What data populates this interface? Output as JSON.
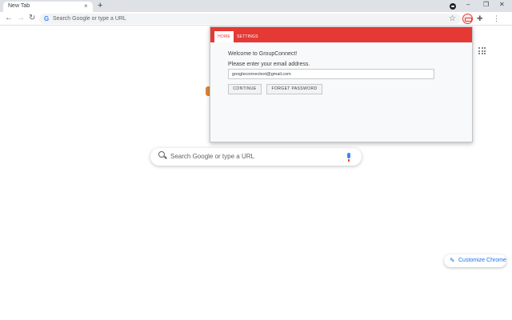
{
  "browser": {
    "tab_title": "New Tab",
    "tab_close": "×",
    "new_tab": "+",
    "win_min": "–",
    "win_restore": "❐",
    "win_close": "✕",
    "nav_back": "←",
    "nav_forward": "→",
    "nav_reload": "↻",
    "omnibox_placeholder": "Search Google or type a URL",
    "star_glyph": "☆",
    "puzzle_glyph": "✚",
    "menu_glyph": "⋮",
    "accent": "#1a73e8"
  },
  "ntp": {
    "search_placeholder": "Search Google or type a URL",
    "customize_label": "Customize Chrome",
    "pencil_glyph": "✎"
  },
  "popup": {
    "brand_color": "#e53935",
    "tabs": [
      {
        "label": "HOME",
        "active": true
      },
      {
        "label": "SETTINGS",
        "active": false
      }
    ],
    "welcome": "Welcome to GroupConnect!",
    "prompt": "Please enter your email address.",
    "email_value": "googleconnectext@gmail.com",
    "continue_label": "CONTINUE",
    "forgot_label": "FORGET PASSWORD"
  }
}
